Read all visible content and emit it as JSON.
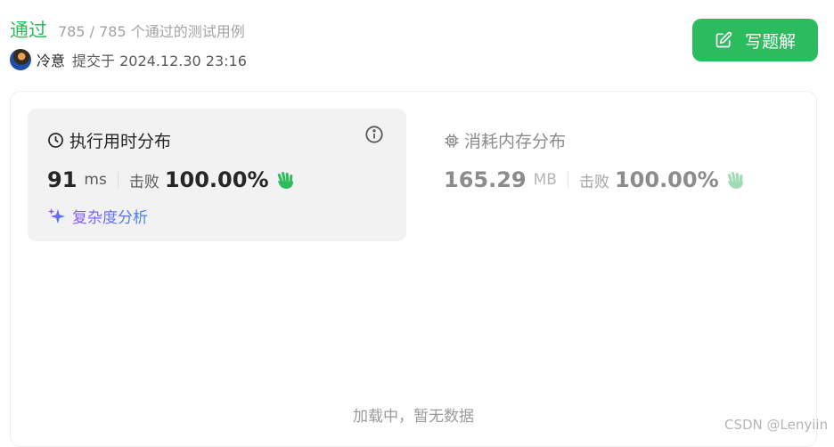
{
  "status": {
    "label": "通过",
    "cases": "785 / 785 个通过的测试用例",
    "color": "#2cbb5d"
  },
  "submitter": {
    "name": "冷意",
    "meta": "提交于 2024.12.30 23:16"
  },
  "write_button": {
    "label": "写题解",
    "icon": "edit-icon"
  },
  "runtime": {
    "title": "执行用时分布",
    "value": "91",
    "unit": "ms",
    "beat_label": "击败",
    "beat_pct": "100.00%",
    "analysis_label": "复杂度分析",
    "icons": [
      "clock-icon",
      "info-icon",
      "clap-icon",
      "sparkle-icon"
    ]
  },
  "memory": {
    "title": "消耗内存分布",
    "value": "165.29",
    "unit": "MB",
    "beat_label": "击败",
    "beat_pct": "100.00%",
    "icons": [
      "chip-icon",
      "clap-icon"
    ]
  },
  "empty_state": "加载中，暂无数据",
  "watermark": "CSDN @Lenyiin"
}
